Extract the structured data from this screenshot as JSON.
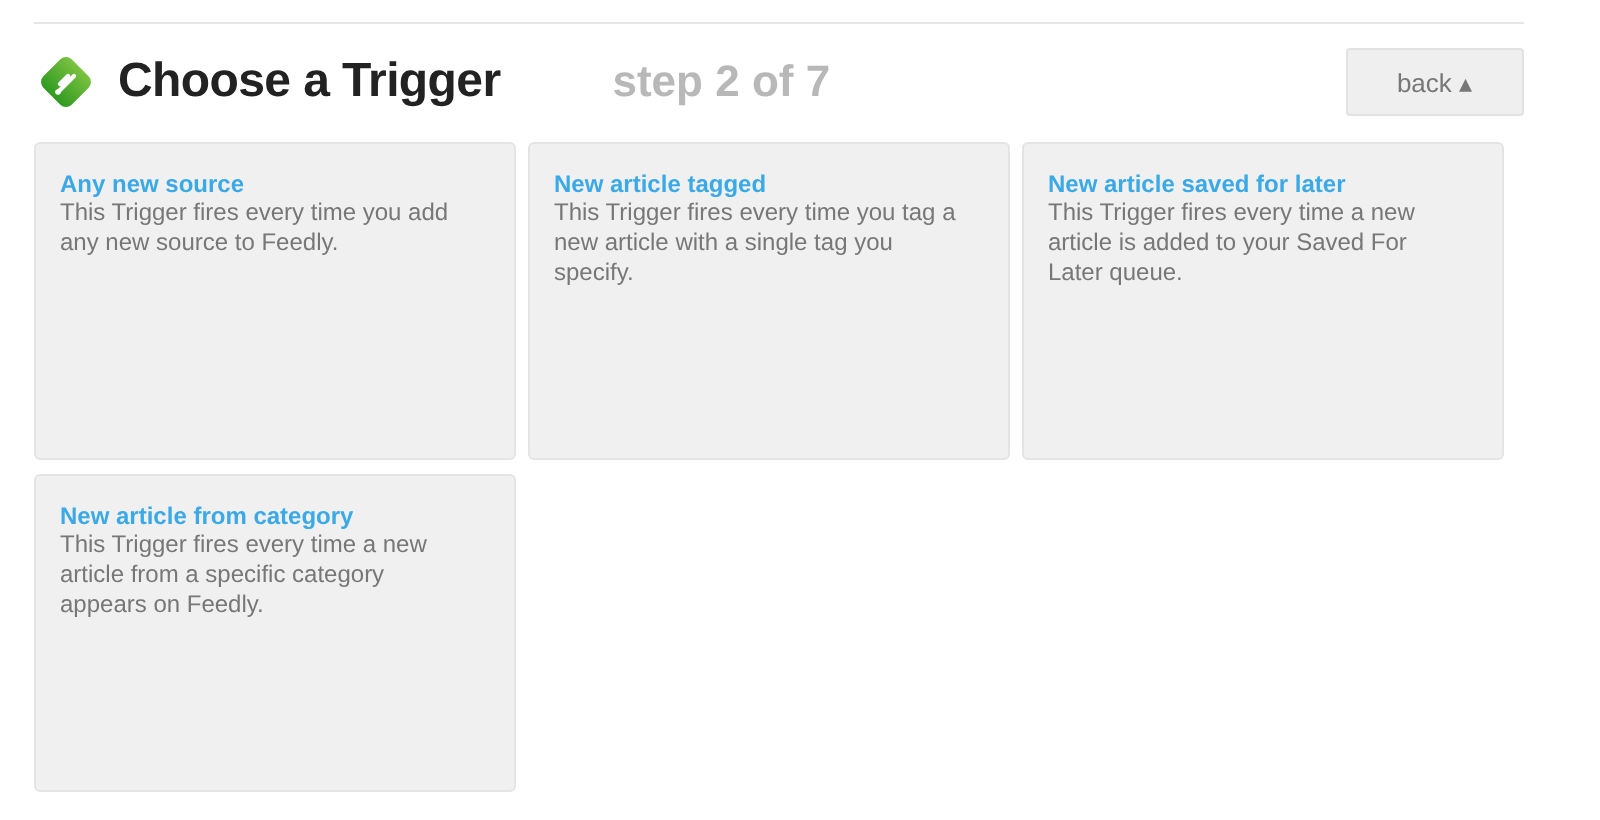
{
  "header": {
    "title": "Choose a Trigger",
    "step": "step 2 of 7",
    "back_button": "back ▴"
  },
  "triggers": [
    {
      "title": "Any new source",
      "description": "This Trigger fires every time you add any new source to Feedly."
    },
    {
      "title": "New article tagged",
      "description": "This Trigger fires every time you tag a new article with a single tag you specify."
    },
    {
      "title": "New article saved for later",
      "description": "This Trigger fires every time a new article is added to your Saved For Later queue."
    },
    {
      "title": "New article from category",
      "description": "This Trigger fires every time a new article from a specific category appears on Feedly."
    }
  ]
}
